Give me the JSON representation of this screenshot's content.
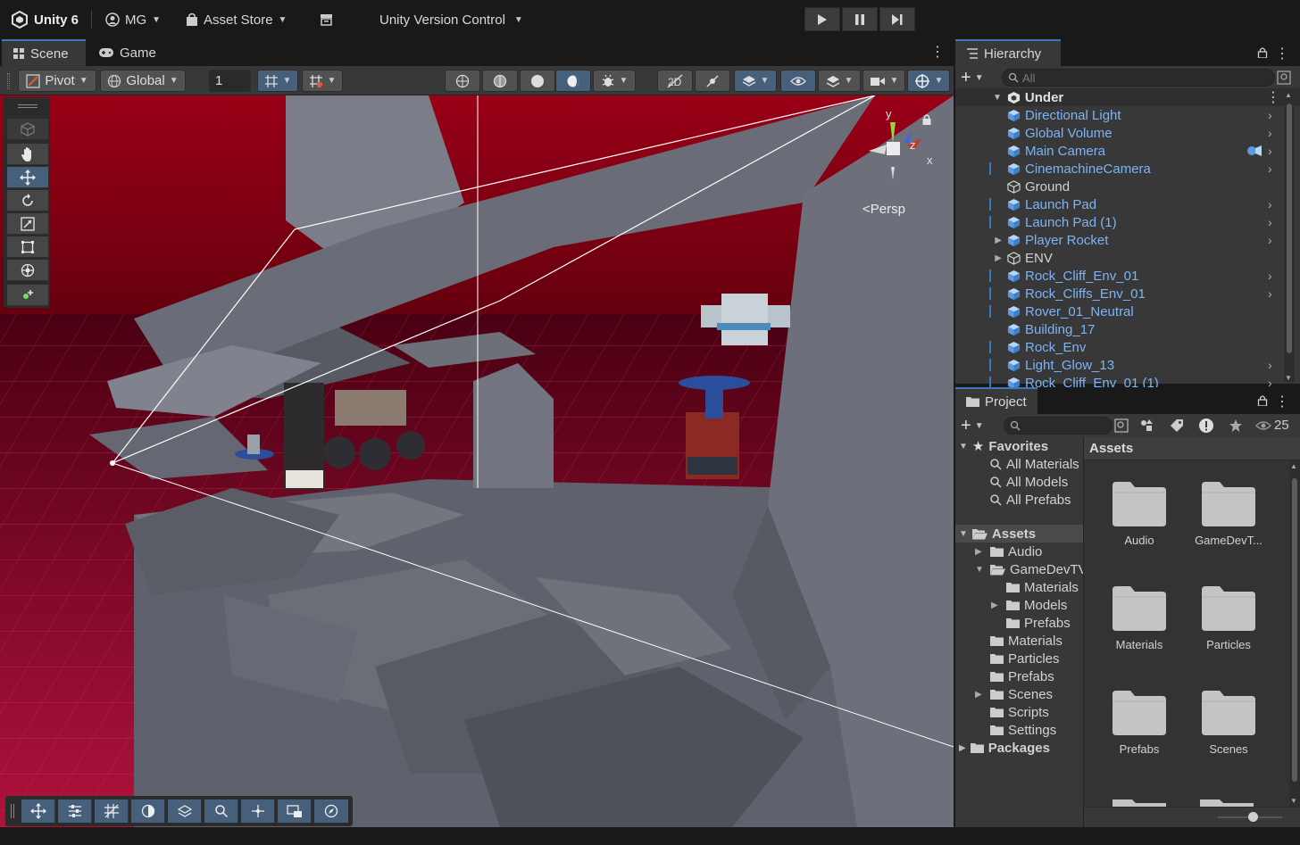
{
  "topbar": {
    "app_name": "Unity 6",
    "account": "MG",
    "asset_store": "Asset Store",
    "version_control": "Unity Version Control"
  },
  "scene_tabs": [
    {
      "label": "Scene",
      "icon": "grid-icon"
    },
    {
      "label": "Game",
      "icon": "gamepad-icon"
    }
  ],
  "scene_toolbar": {
    "pivot": "Pivot",
    "global": "Global",
    "grid_increment": "1"
  },
  "scene_view": {
    "projection": "Persp",
    "gizmo_axes": [
      "y",
      "z",
      "x"
    ]
  },
  "hierarchy": {
    "title": "Hierarchy",
    "search_placeholder": "All",
    "scene_name": "Under",
    "items": [
      {
        "label": "Directional Light",
        "type": "prefab",
        "has_arrow": true,
        "has_line": false
      },
      {
        "label": "Global Volume",
        "type": "prefab",
        "has_arrow": true,
        "has_line": false
      },
      {
        "label": "Main Camera",
        "type": "prefab",
        "has_arrow": true,
        "has_line": false
      },
      {
        "label": "CinemachineCamera",
        "type": "prefab",
        "has_arrow": true,
        "has_line": true
      },
      {
        "label": "Ground",
        "type": "object",
        "has_arrow": false,
        "has_line": false
      },
      {
        "label": "Launch Pad",
        "type": "prefab",
        "has_arrow": true,
        "has_line": true
      },
      {
        "label": "Launch Pad (1)",
        "type": "prefab",
        "has_arrow": true,
        "has_line": true
      },
      {
        "label": "Player Rocket",
        "type": "prefab",
        "has_arrow": true,
        "has_line": false,
        "expandable": true
      },
      {
        "label": "ENV",
        "type": "object",
        "has_arrow": false,
        "has_line": false,
        "expandable": true
      },
      {
        "label": "Rock_Cliff_Env_01",
        "type": "prefab",
        "has_arrow": true,
        "has_line": true
      },
      {
        "label": "Rock_Cliffs_Env_01",
        "type": "prefab",
        "has_arrow": true,
        "has_line": true
      },
      {
        "label": "Rover_01_Neutral",
        "type": "prefab",
        "has_arrow": false,
        "has_line": true
      },
      {
        "label": "Building_17",
        "type": "prefab",
        "has_arrow": false,
        "has_line": false
      },
      {
        "label": "Rock_Env",
        "type": "prefab",
        "has_arrow": false,
        "has_line": true
      },
      {
        "label": "Light_Glow_13",
        "type": "prefab",
        "has_arrow": true,
        "has_line": true
      },
      {
        "label": "Rock_Cliff_Env_01 (1)",
        "type": "prefab",
        "has_arrow": true,
        "has_line": true
      }
    ]
  },
  "project": {
    "title": "Project",
    "hidden_count": "25",
    "favorites_label": "Favorites",
    "favorites": [
      "All Materials",
      "All Models",
      "All Prefabs"
    ],
    "assets_label": "Assets",
    "tree": [
      {
        "label": "Audio",
        "indent": 1,
        "arrow": "right"
      },
      {
        "label": "GameDevTV",
        "indent": 1,
        "arrow": "down"
      },
      {
        "label": "Materials",
        "indent": 2,
        "arrow": ""
      },
      {
        "label": "Models",
        "indent": 2,
        "arrow": "right"
      },
      {
        "label": "Prefabs",
        "indent": 2,
        "arrow": ""
      },
      {
        "label": "Materials",
        "indent": 1,
        "arrow": ""
      },
      {
        "label": "Particles",
        "indent": 1,
        "arrow": ""
      },
      {
        "label": "Prefabs",
        "indent": 1,
        "arrow": ""
      },
      {
        "label": "Scenes",
        "indent": 1,
        "arrow": "right"
      },
      {
        "label": "Scripts",
        "indent": 1,
        "arrow": ""
      },
      {
        "label": "Settings",
        "indent": 1,
        "arrow": ""
      }
    ],
    "packages_label": "Packages",
    "breadcrumb": "Assets",
    "grid_items": [
      "Audio",
      "GameDevT...",
      "Materials",
      "Particles",
      "Prefabs",
      "Scenes"
    ]
  },
  "colors": {
    "accent": "#3a79bb",
    "prefab_text": "#7cb4f4",
    "sky_red": "#8a0018"
  }
}
